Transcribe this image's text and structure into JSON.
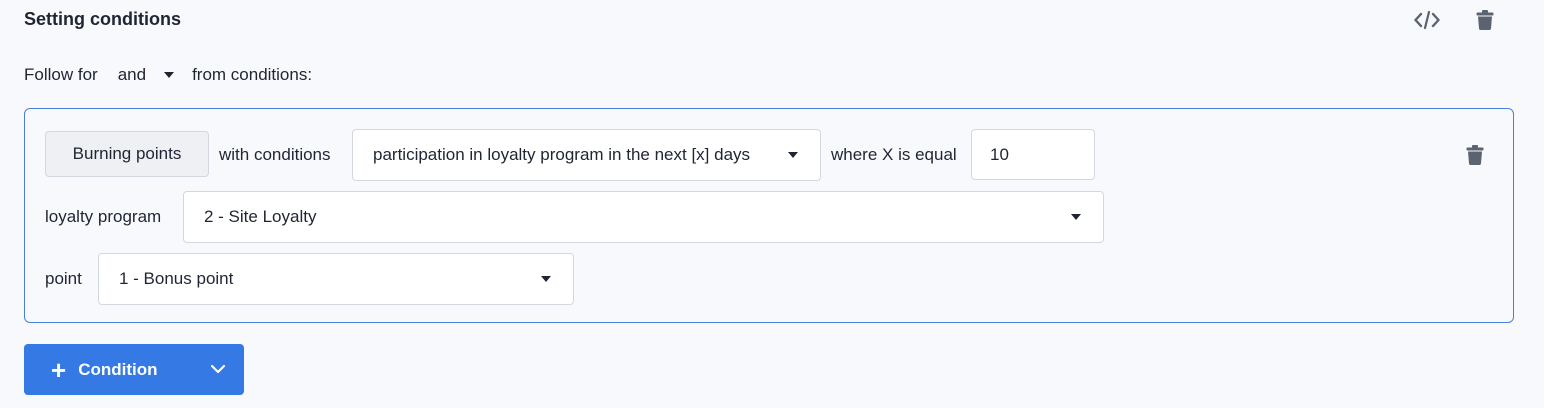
{
  "header": {
    "title": "Setting conditions",
    "code_icon": "code-icon",
    "delete_icon": "trash-icon"
  },
  "follow": {
    "prefix": "Follow for",
    "operator": "and",
    "suffix": "from conditions:"
  },
  "condition": {
    "type_label": "Burning points",
    "with_conditions_label": "with conditions",
    "condition_select": "participation in loyalty program in the next [x] days",
    "where_label": "where X is equal",
    "x_value": "10",
    "loyalty_program_label": "loyalty program",
    "loyalty_program_value": "2 - Site Loyalty",
    "point_label": "point",
    "point_value": "1 - Bonus point",
    "delete_icon": "trash-icon"
  },
  "add_button": {
    "icon": "plus-icon",
    "label": "Condition",
    "dropdown_icon": "chevron-down-icon"
  },
  "colors": {
    "accent": "#3479e4",
    "border_active": "#4a80d8",
    "background": "#f8f9fc",
    "icon": "#5c6370"
  }
}
